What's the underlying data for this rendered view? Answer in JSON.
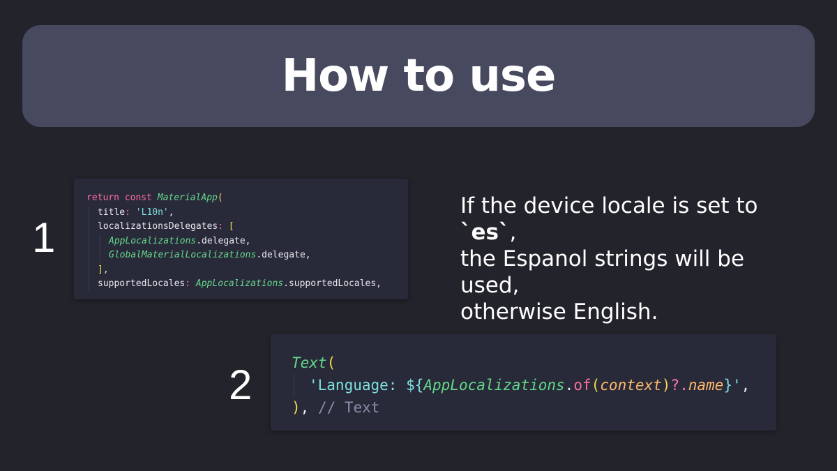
{
  "header": {
    "title": "How to use"
  },
  "steps": [
    {
      "number": "1",
      "code": [
        {
          "indent": 0,
          "tokens": [
            [
              "kw",
              "return const "
            ],
            [
              "cls",
              "MaterialApp"
            ],
            [
              "paren",
              "("
            ]
          ]
        },
        {
          "indent": 1,
          "tokens": [
            [
              "id",
              "title"
            ],
            [
              "kw",
              ": "
            ],
            [
              "str",
              "'L10n'"
            ],
            [
              "punc",
              ","
            ]
          ]
        },
        {
          "indent": 1,
          "tokens": [
            [
              "id",
              "localizationsDelegates"
            ],
            [
              "kw",
              ": "
            ],
            [
              "paren",
              "["
            ]
          ]
        },
        {
          "indent": 2,
          "tokens": [
            [
              "cls",
              "AppLocalizations"
            ],
            [
              "punc",
              ".delegate,"
            ]
          ]
        },
        {
          "indent": 2,
          "tokens": [
            [
              "cls",
              "GlobalMaterialLocalizations"
            ],
            [
              "punc",
              ".delegate,"
            ]
          ]
        },
        {
          "indent": 1,
          "tokens": [
            [
              "paren",
              "]"
            ],
            [
              "punc",
              ","
            ]
          ]
        },
        {
          "indent": 1,
          "tokens": [
            [
              "id",
              "supportedLocales"
            ],
            [
              "kw",
              ": "
            ],
            [
              "cls",
              "AppLocalizations"
            ],
            [
              "punc",
              ".supportedLocales,"
            ]
          ]
        }
      ]
    },
    {
      "number": "2",
      "code": [
        {
          "indent": 0,
          "tokens": [
            [
              "cls2",
              "Text"
            ],
            [
              "paren",
              "("
            ]
          ]
        },
        {
          "indent": 1,
          "tokens": [
            [
              "str",
              "'Language: ${"
            ],
            [
              "cls2",
              "AppLocalizations"
            ],
            [
              "punc",
              "."
            ],
            [
              "fn2",
              "of"
            ],
            [
              "paren",
              "("
            ],
            [
              "arg2",
              "context"
            ],
            [
              "paren",
              ")"
            ],
            [
              "pink",
              "?."
            ],
            [
              "arg2",
              "name"
            ],
            [
              "str",
              "}'"
            ],
            [
              "punc",
              ","
            ]
          ]
        },
        {
          "indent": 0,
          "tokens": [
            [
              "paren",
              ")"
            ],
            [
              "punc",
              ", "
            ],
            [
              "cmt",
              "// Text"
            ]
          ]
        }
      ]
    }
  ],
  "description": {
    "line1_prefix": "If the device locale is set to ",
    "line1_code": "`es`",
    "line1_suffix": ",",
    "line2": "the Espanol strings will be used,",
    "line3": "otherwise English."
  }
}
